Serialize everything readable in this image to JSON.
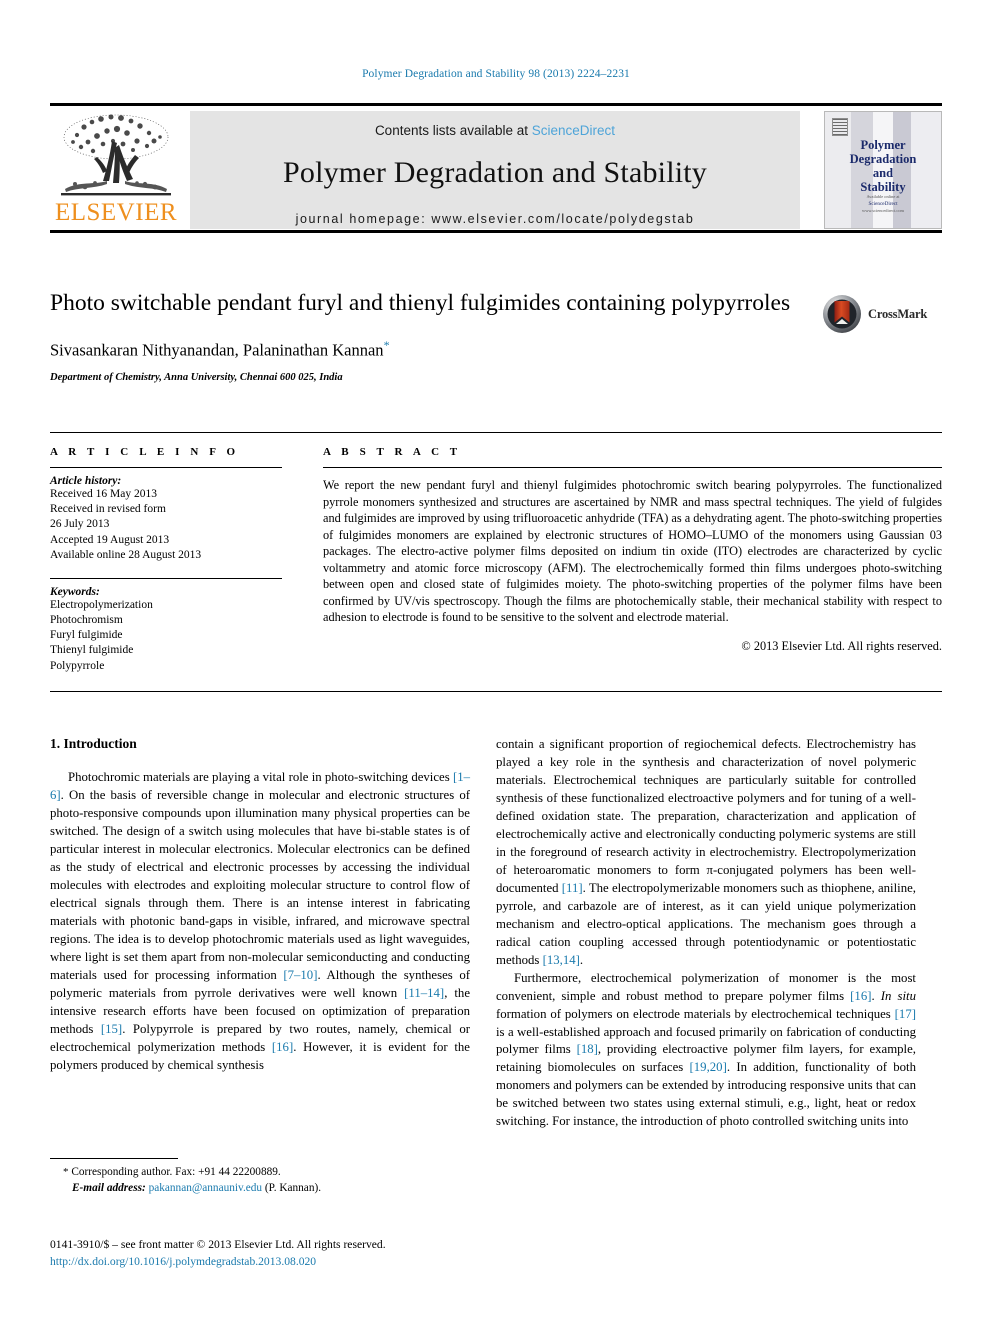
{
  "running_head": "Polymer Degradation and Stability 98 (2013) 2224–2231",
  "masthead": {
    "publisher_name": "ELSEVIER",
    "contents_prefix": "Contents lists available at ",
    "contents_link": "ScienceDirect",
    "journal_title": "Polymer Degradation and Stability",
    "homepage": "journal homepage: www.elsevier.com/locate/polydegstab",
    "cover": {
      "title_line1": "Polymer",
      "title_line2": "Degradation",
      "title_line3": "and",
      "title_line4": "Stability",
      "footer_line1": "Available online at",
      "footer_line2": "ScienceDirect",
      "footer_line3": "www.sciencedirect.com"
    }
  },
  "article": {
    "title": "Photo switchable pendant furyl and thienyl fulgimides containing polypyrroles",
    "authors": "Sivasankaran Nithyanandan, Palaninathan Kannan",
    "author_star": "*",
    "affiliation": "Department of Chemistry, Anna University, Chennai 600 025, India",
    "crossmark_label": "CrossMark"
  },
  "info": {
    "heading": "A R T I C L E    I N F O",
    "history_label": "Article history:",
    "history_lines": [
      "Received 16 May 2013",
      "Received in revised form",
      "26 July 2013",
      "Accepted 19 August 2013",
      "Available online 28 August 2013"
    ],
    "keywords_label": "Keywords:",
    "keywords": [
      "Electropolymerization",
      "Photochromism",
      "Furyl fulgimide",
      "Thienyl fulgimide",
      "Polypyrrole"
    ]
  },
  "abstract": {
    "heading": "A B S T R A C T",
    "text": "We report the new pendant furyl and thienyl fulgimides photochromic switch bearing polypyrroles. The functionalized pyrrole monomers synthesized and structures are ascertained by NMR and mass spectral techniques. The yield of fulgides and fulgimides are improved by using trifluoroacetic anhydride (TFA) as a dehydrating agent. The photo-switching properties of fulgimides monomers are explained by electronic structures of HOMO–LUMO of the monomers using Gaussian 03 packages. The electro-active polymer films deposited on indium tin oxide (ITO) electrodes are characterized by cyclic voltammetry and atomic force microscopy (AFM). The electrochemically formed thin films undergoes photo-switching between open and closed state of fulgimides moiety. The photo-switching properties of the polymer films have been confirmed by UV/vis spectroscopy. Though the films are photochemically stable, their mechanical stability with respect to adhesion to electrode is found to be sensitive to the solvent and electrode material.",
    "copyright": "© 2013 Elsevier Ltd. All rights reserved."
  },
  "body": {
    "section_number_title": "1.  Introduction",
    "left_paragraph_1_a": "Photochromic materials are playing a vital role in photo-switching devices ",
    "left_ref_1": "[1–6]",
    "left_paragraph_1_b": ". On the basis of reversible change in molecular and electronic structures of photo-responsive compounds upon illumination many physical properties can be switched. The design of a switch using molecules that have bi-stable states is of particular interest in molecular electronics. Molecular electronics can be defined as the study of electrical and electronic processes by accessing the individual molecules with electrodes and exploiting molecular structure to control flow of electrical signals through them. There is an intense interest in fabricating materials with photonic band-gaps in visible, infrared, and microwave spectral regions. The idea is to develop photochromic materials used as light waveguides, where light is set them apart from non-molecular semiconducting and conducting materials used for processing information ",
    "left_ref_2": "[7–10]",
    "left_paragraph_1_c": ". Although the syntheses of polymeric materials from pyrrole derivatives were well known ",
    "left_ref_3": "[11–14]",
    "left_paragraph_1_d": ", the intensive research efforts have been focused on optimization of preparation methods ",
    "left_ref_4": "[15]",
    "left_paragraph_1_e": ". Polypyrrole is prepared by two routes, namely, chemical or electrochemical polymerization methods ",
    "left_ref_5": "[16]",
    "left_paragraph_1_f": ". However, it is evident for the polymers produced by chemical synthesis",
    "right_paragraph_1_a": "contain a significant proportion of regiochemical defects. Electrochemistry has played a key role in the synthesis and characterization of novel polymeric materials. Electrochemical techniques are particularly suitable for controlled synthesis of these functionalized electroactive polymers and for tuning of a well-defined oxidation state. The preparation, characterization and application of electrochemically active and electronically conducting polymeric systems are still in the foreground of research activity in electrochemistry. Electropolymerization of heteroaromatic monomers to form π-conjugated polymers has been well-documented ",
    "right_ref_1": "[11]",
    "right_paragraph_1_b": ". The electropolymerizable monomers such as thiophene, aniline, pyrrole, and carbazole are of interest, as it can yield unique polymerization mechanism and electro-optical applications. The mechanism goes through a radical cation coupling accessed through potentiodynamic or potentiostatic methods ",
    "right_ref_2": "[13,14]",
    "right_paragraph_1_c": ".",
    "right_paragraph_2_a": "Furthermore, electrochemical polymerization of monomer is the most convenient, simple and robust method to prepare polymer films ",
    "right_ref_3": "[16]",
    "right_paragraph_2_b": ". ",
    "right_italic_1": "In situ",
    "right_paragraph_2_c": " formation of polymers on electrode materials by electrochemical techniques ",
    "right_ref_4": "[17]",
    "right_paragraph_2_d": " is a well-established approach and focused primarily on fabrication of conducting polymer films ",
    "right_ref_5": "[18]",
    "right_paragraph_2_e": ", providing electroactive polymer film layers, for example, retaining biomolecules on surfaces ",
    "right_ref_6": "[19,20]",
    "right_paragraph_2_f": ". In addition, functionality of both monomers and polymers can be extended by introducing responsive units that can be switched between two states using external stimuli, e.g., light, heat or redox switching. For instance, the introduction of photo controlled switching units into"
  },
  "footnote": {
    "star": "*",
    "corresponding": " Corresponding author. Fax: +91 44 22200889.",
    "email_label": "E-mail address:",
    "email": "pakannan@annauniv.edu",
    "email_suffix": " (P. Kannan)."
  },
  "colophon": {
    "issn_line": "0141-3910/$ – see front matter © 2013 Elsevier Ltd. All rights reserved.",
    "doi": "http://dx.doi.org/10.1016/j.polymdegradstab.2013.08.020"
  },
  "colors": {
    "link_blue": "#1a7aad",
    "science_direct_blue": "#4ea4d8",
    "elsevier_orange": "#ee8f1e",
    "cover_navy": "#1b2a6b",
    "banner_grey": "#e4e4e4"
  }
}
